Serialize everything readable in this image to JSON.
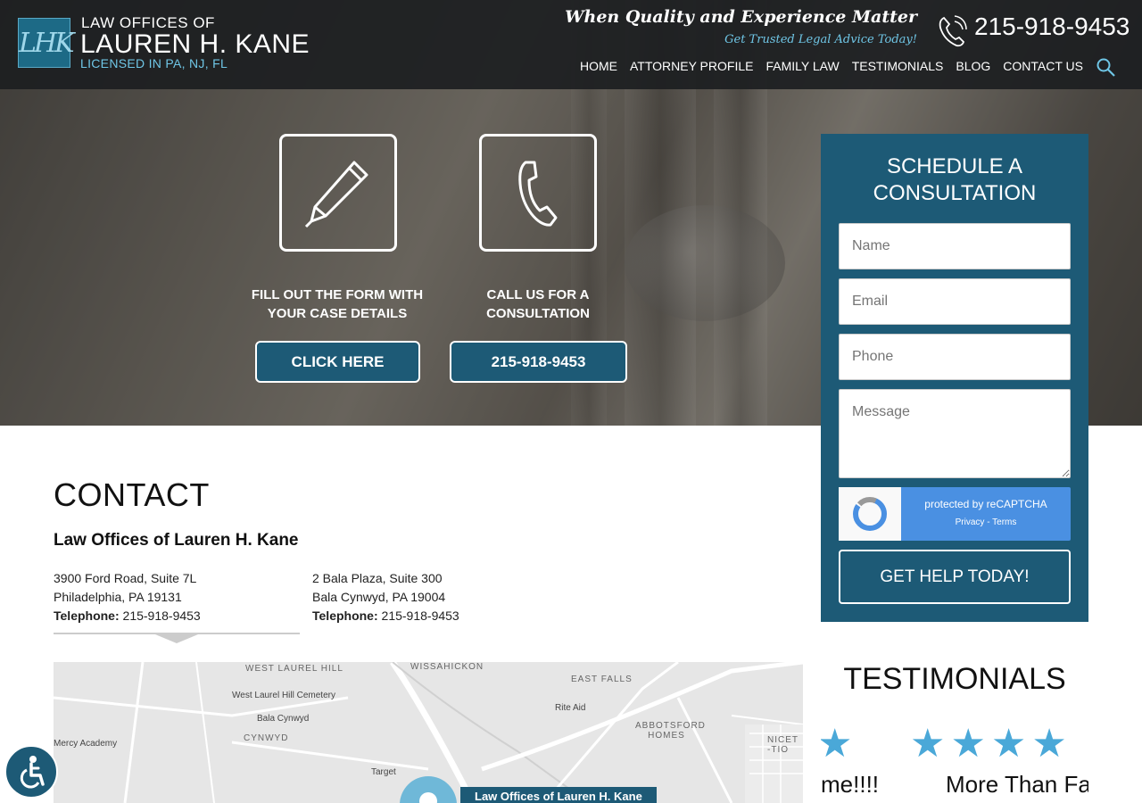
{
  "header": {
    "logo_mark": "LHK",
    "logo_line1": "LAW OFFICES OF",
    "logo_line2": "LAUREN H. KANE",
    "logo_line3": "LICENSED IN PA, NJ, FL",
    "tagline": "When Quality and Experience Matter",
    "subtagline": "Get Trusted Legal Advice Today!",
    "phone": "215-918-9453",
    "nav": [
      "HOME",
      "ATTORNEY PROFILE",
      "FAMILY LAW",
      "TESTIMONIALS",
      "BLOG",
      "CONTACT US"
    ]
  },
  "cta": {
    "form_text": "FILL OUT THE FORM WITH YOUR CASE DETAILS",
    "form_button": "CLICK HERE",
    "call_text": "CALL US FOR A CONSULTATION",
    "call_button": "215-918-9453"
  },
  "form": {
    "title": "SCHEDULE A CONSULTATION",
    "name_placeholder": "Name",
    "email_placeholder": "Email",
    "phone_placeholder": "Phone",
    "message_placeholder": "Message",
    "captcha_text": "protected by reCAPTCHA",
    "captcha_links": "Privacy - Terms",
    "submit": "GET HELP TODAY!"
  },
  "contact": {
    "heading": "CONTACT",
    "firm": "Law Offices of Lauren H. Kane",
    "office1": {
      "line1": "3900 Ford Road, Suite 7L",
      "line2": "Philadelphia, PA 19131",
      "tel_label": "Telephone:",
      "tel": "215-918-9453"
    },
    "office2": {
      "line1": "2 Bala Plaza, Suite 300",
      "line2": "Bala Cynwyd, PA 19004",
      "tel_label": "Telephone:",
      "tel": "215-918-9453"
    }
  },
  "map": {
    "labels": [
      "WEST LAUREL HILL",
      "West Laurel Hill Cemetery",
      "Bala Cynwyd",
      "CYNWYD",
      "WISSAHICKON",
      "EAST FALLS",
      "ABBOTSFORD HOMES",
      "Rite Aid",
      "Target",
      "Mercy Academy",
      "NICET -TIO"
    ],
    "card": "Law Offices of Lauren H. Kane"
  },
  "testimonials": {
    "heading": "TESTIMONIALS",
    "quote1": "me!!!!",
    "quote2": "More Than Fa"
  }
}
